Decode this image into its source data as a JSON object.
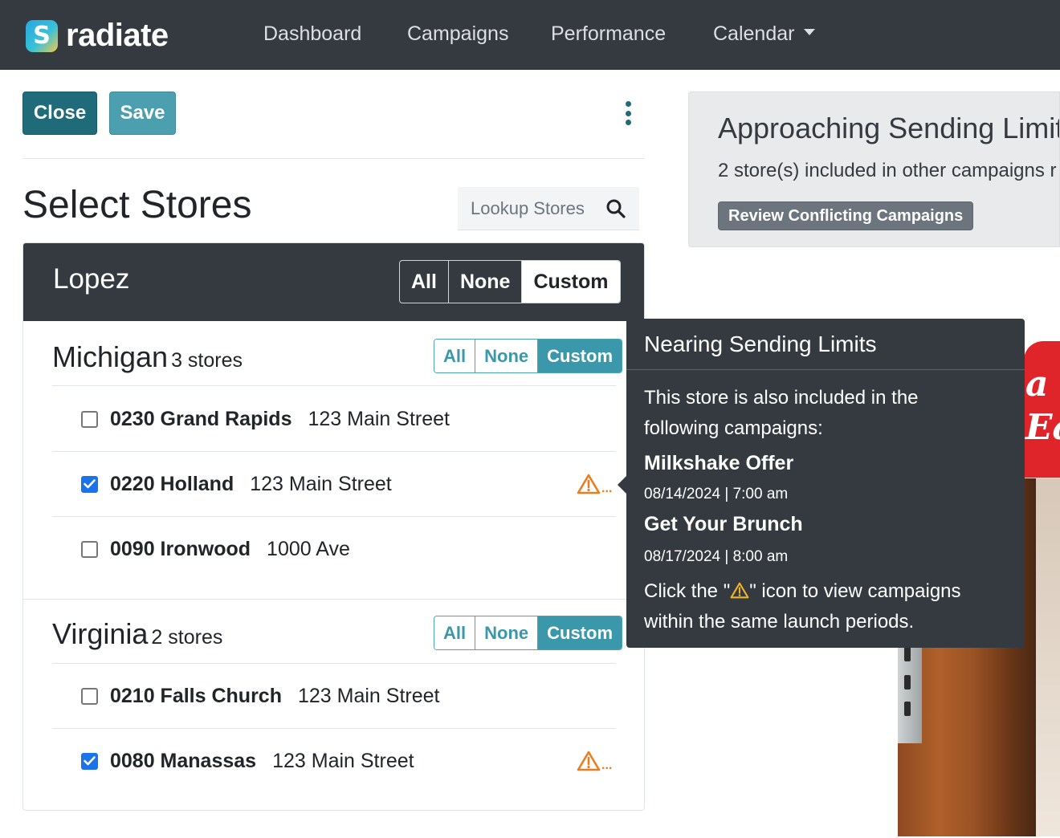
{
  "brand": {
    "name": "radiate",
    "logo_letter": "S"
  },
  "nav": {
    "items": [
      "Dashboard",
      "Campaigns",
      "Performance",
      "Calendar"
    ]
  },
  "toolbar": {
    "close_label": "Close",
    "save_label": "Save"
  },
  "page": {
    "title": "Select Stores"
  },
  "search": {
    "placeholder": "Lookup Stores"
  },
  "group": {
    "name": "Lopez",
    "options": [
      "All",
      "None",
      "Custom"
    ],
    "selected": "Custom"
  },
  "states": [
    {
      "name": "Michigan",
      "count": "3 stores",
      "options": [
        "All",
        "None",
        "Custom"
      ],
      "selected": "Custom",
      "stores": [
        {
          "name": "0230 Grand Rapids",
          "address": "123 Main Street",
          "checked": false,
          "warning": false
        },
        {
          "name": "0220 Holland",
          "address": "123 Main Street",
          "checked": true,
          "warning": true
        },
        {
          "name": "0090 Ironwood",
          "address": "1000 Ave",
          "checked": false,
          "warning": false
        }
      ]
    },
    {
      "name": "Virginia",
      "count": "2 stores",
      "options": [
        "All",
        "None",
        "Custom"
      ],
      "selected": "Custom",
      "stores": [
        {
          "name": "0210 Falls Church",
          "address": "123 Main Street",
          "checked": false,
          "warning": false
        },
        {
          "name": "0080 Manassas",
          "address": "123 Main Street",
          "checked": true,
          "warning": true
        }
      ]
    }
  ],
  "limits": {
    "title": "Approaching Sending Limits",
    "text": "2 store(s) included in other campaigns r",
    "button": "Review Conflicting Campaigns"
  },
  "tooltip": {
    "title": "Nearing Sending Limits",
    "intro_line1": "This store is also included in the",
    "intro_line2": "following campaigns:",
    "campaigns": [
      {
        "name": "Milkshake Offer",
        "date": "08/14/2024 | 7:00 am"
      },
      {
        "name": "Get Your Brunch",
        "date": "08/17/2024 | 8:00 am"
      }
    ],
    "footer_pre": "Click the \"",
    "footer_post": "\" icon to view campaigns",
    "footer_line2": "within the same launch periods."
  },
  "photo": {
    "text_line1": "a",
    "text_line2": "Ea"
  },
  "colors": {
    "navbar": "#343a40",
    "primary_dark_teal": "#1f6b7a",
    "teal": "#3b97aa",
    "warning": "#e67e22",
    "checkbox": "#1a73e8"
  },
  "icons": {
    "search": "search-icon",
    "kebab": "more-vertical-icon",
    "warning": "warning-triangle-icon",
    "caret": "chevron-down-icon",
    "check": "check-icon"
  }
}
